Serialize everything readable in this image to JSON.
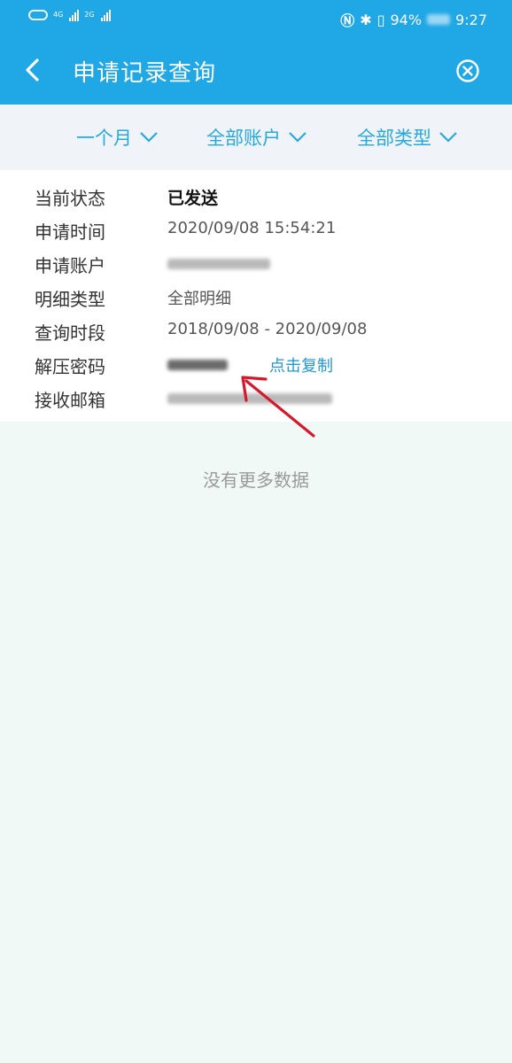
{
  "status_bar": {
    "network_1": "4G",
    "network_2": "2G",
    "battery": "94%",
    "time": "9:27"
  },
  "header": {
    "title": "申请记录查询",
    "back_icon": "chevron-left-icon",
    "close_icon": "close-circle-icon"
  },
  "filters": {
    "period": "一个月",
    "account": "全部账户",
    "type": "全部类型"
  },
  "record": {
    "status_label": "当前状态",
    "status_value": "已发送",
    "time_label": "申请时间",
    "time_value": "2020/09/08 15:54:21",
    "account_label": "申请账户",
    "detail_type_label": "明细类型",
    "detail_type_value": "全部明细",
    "period_label": "查询时段",
    "period_value": "2018/09/08 - 2020/09/08",
    "password_label": "解压密码",
    "copy_label": "点击复制",
    "email_label": "接收邮箱"
  },
  "footer": {
    "no_more": "没有更多数据"
  },
  "colors": {
    "header_bg": "#1fa7e6",
    "accent": "#26a8e0",
    "arrow": "#d7182a",
    "page_bg": "#f1f9f7"
  }
}
